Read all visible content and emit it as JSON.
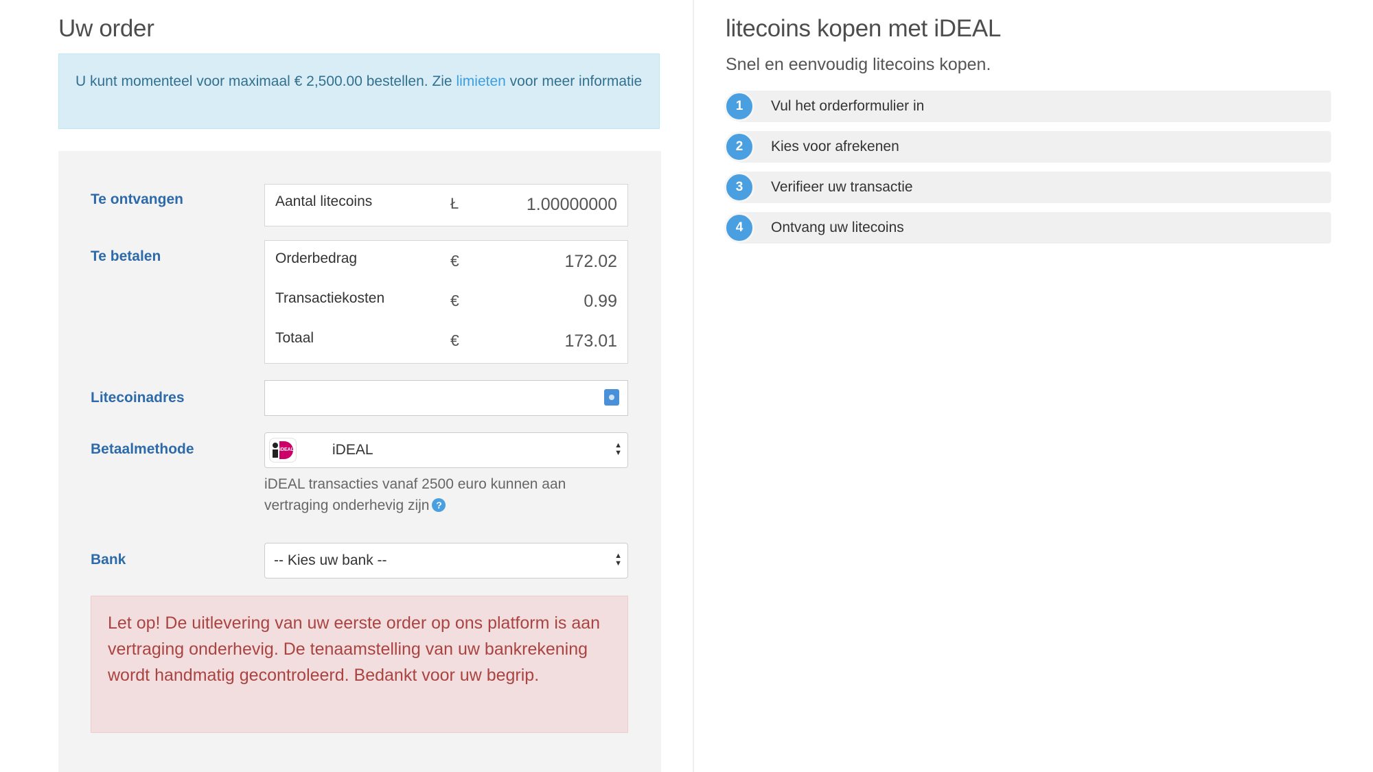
{
  "order": {
    "title": "Uw order",
    "info": {
      "text_before": "U kunt momenteel voor maximaal € 2,500.00 bestellen. Zie ",
      "link": "limieten",
      "text_after": " voor meer informatie"
    },
    "receive": {
      "label": "Te ontvangen",
      "row_label": "Aantal litecoins",
      "symbol": "Ł",
      "value": "1.00000000"
    },
    "pay": {
      "label": "Te betalen",
      "rows": [
        {
          "label": "Orderbedrag",
          "symbol": "€",
          "value": "172.02"
        },
        {
          "label": "Transactiekosten",
          "symbol": "€",
          "value": "0.99"
        },
        {
          "label": "Totaal",
          "symbol": "€",
          "value": "173.01"
        }
      ]
    },
    "address": {
      "label": "Litecoinadres",
      "value": "",
      "icon": "address-book-icon"
    },
    "payment_method": {
      "label": "Betaalmethode",
      "selected": "iDEAL",
      "logo_text": "iDEAL",
      "help": "iDEAL transacties vanaf 2500 euro kunnen aan vertraging onderhevig zijn",
      "help_icon": "?"
    },
    "bank": {
      "label": "Bank",
      "selected": "-- Kies uw bank --"
    },
    "alert": "Let op! De uitlevering van uw eerste order op ons platform is aan vertraging onderhevig. De tenaamstelling van uw bankrekening wordt handmatig gecontroleerd. Bedankt voor uw begrip."
  },
  "sidebar": {
    "title": "litecoins kopen met iDEAL",
    "subtitle": "Snel en eenvoudig litecoins kopen.",
    "steps": [
      {
        "num": "1",
        "text": "Vul het orderformulier in"
      },
      {
        "num": "2",
        "text": "Kies voor afrekenen"
      },
      {
        "num": "3",
        "text": "Verifieer uw transactie"
      },
      {
        "num": "4",
        "text": "Ontvang uw litecoins"
      }
    ]
  },
  "colors": {
    "label_blue": "#2d6aa9",
    "info_bg": "#d9edf7",
    "alert_bg": "#f2dede",
    "alert_text": "#a94442",
    "step_badge": "#4a9fe0"
  }
}
